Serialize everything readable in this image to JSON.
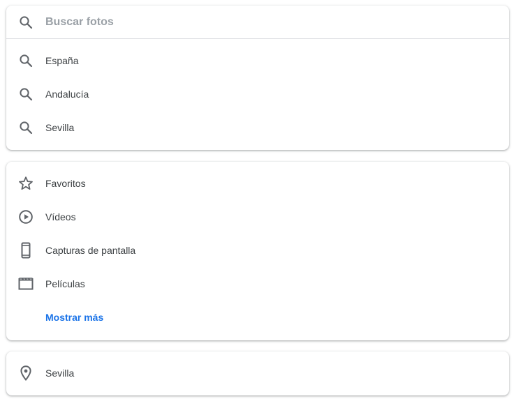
{
  "search": {
    "placeholder": "Buscar fotos",
    "value": ""
  },
  "suggestions": [
    {
      "label": "España",
      "icon": "search-icon"
    },
    {
      "label": "Andalucía",
      "icon": "search-icon"
    },
    {
      "label": "Sevilla",
      "icon": "search-icon"
    }
  ],
  "categories": [
    {
      "label": "Favoritos",
      "icon": "star-outline-icon"
    },
    {
      "label": "Vídeos",
      "icon": "play-circle-icon"
    },
    {
      "label": "Capturas de pantalla",
      "icon": "phone-screenshot-icon"
    },
    {
      "label": "Películas",
      "icon": "movie-clapper-icon"
    }
  ],
  "show_more": {
    "label": "Mostrar más"
  },
  "places": [
    {
      "label": "Sevilla",
      "icon": "location-pin-icon"
    }
  ],
  "colors": {
    "text": "#3c4043",
    "icon": "#5f6368",
    "placeholder": "#9aa0a6",
    "link": "#1a73e8",
    "divider": "#dadce0"
  }
}
